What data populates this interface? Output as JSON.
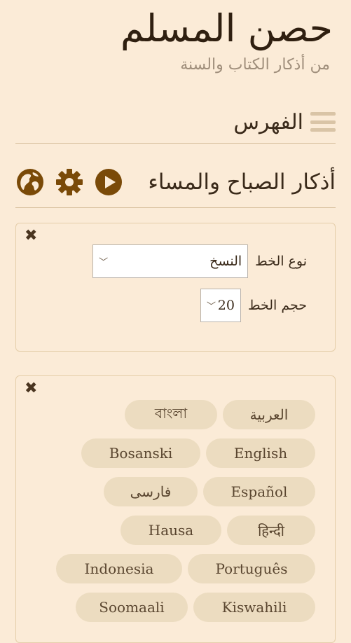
{
  "header": {
    "title": "حصن المسلم",
    "subtitle": "من أذكار الكتاب والسنة"
  },
  "index": {
    "label": "الفهرس",
    "menu_icon": "hamburger-icon"
  },
  "section": {
    "title": "أذكار الصباح والمساء",
    "icons": [
      "play-icon",
      "gear-icon",
      "globe-icon"
    ]
  },
  "settings_panel": {
    "font_type_label": "نوع الخط",
    "font_type_value": "النسخ",
    "font_size_label": "حجم الخط",
    "font_size_value": "20"
  },
  "languages": {
    "rows": [
      [
        "العربية",
        "বাংলা"
      ],
      [
        "English",
        "Bosanski"
      ],
      [
        "Español",
        "فارسی"
      ],
      [
        "हिन्दी",
        "Hausa"
      ],
      [
        "Português",
        "Indonesia"
      ],
      [
        "Kiswahili",
        "Soomaali"
      ]
    ]
  },
  "colors": {
    "background": "#fbebd7",
    "accent": "#8a5a10",
    "button_bg": "#ecdcc0"
  }
}
